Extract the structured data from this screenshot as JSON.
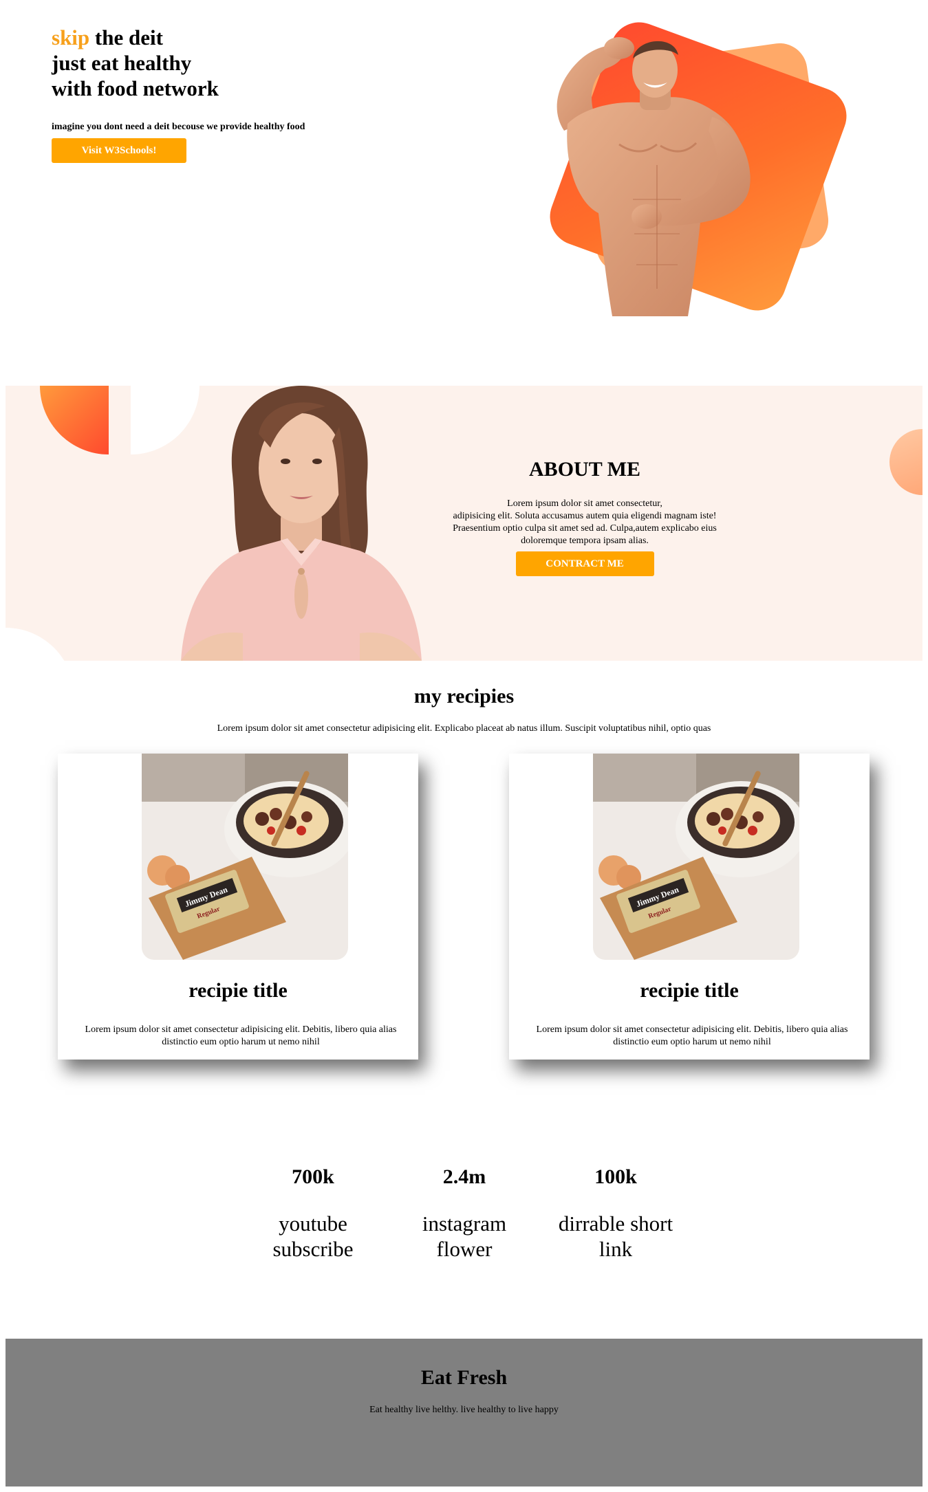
{
  "hero": {
    "title_accent": "skip",
    "title_line1_rest": " the deit",
    "title_line2": "just eat healthy",
    "title_line3": "with food network",
    "subtitle": "imagine you dont need a deit becouse we provide healthy food",
    "button_label": "Visit W3Schools!"
  },
  "about": {
    "title": "ABOUT ME",
    "text_line1": "Lorem ipsum dolor sit amet consectetur,",
    "text_line2": "adipisicing elit. Soluta accusamus autem quia eligendi magnam iste!",
    "text_line3": "Praesentium optio culpa sit amet sed ad. Culpa,autem explicabo eius",
    "text_line4": "doloremque tempora ipsam alias.",
    "button_label": "CONTRACT ME"
  },
  "recipes": {
    "title": "my recipies",
    "subtitle": "Lorem ipsum dolor sit amet consectetur adipisicing elit. Explicabo placeat ab natus illum. Suscipit voluptatibus nihil, optio quas",
    "cards": [
      {
        "title": "recipie title",
        "text": "Lorem ipsum dolor sit amet consectetur adipisicing elit. Debitis, libero quia alias distinctio eum optio harum ut nemo nihil",
        "package_brand": "Jimmy Dean",
        "package_label": "Regular"
      },
      {
        "title": "recipie title",
        "text": "Lorem ipsum dolor sit amet consectetur adipisicing elit. Debitis, libero quia alias distinctio eum optio harum ut nemo nihil",
        "package_brand": "Jimmy Dean",
        "package_label": "Regular"
      }
    ]
  },
  "stats": [
    {
      "value": "700k",
      "label_line1": "youtube",
      "label_line2": "subscribe"
    },
    {
      "value": "2.4m",
      "label_line1": "instagram",
      "label_line2": "flower"
    },
    {
      "value": "100k",
      "label_line1": "dirrable short",
      "label_line2": "link"
    }
  ],
  "footer": {
    "title": "Eat Fresh",
    "text": "Eat healthy live helthy. live healthy to live happy"
  },
  "colors": {
    "accent": "#ffa500",
    "accent_text": "#f7a01b",
    "about_bg": "#fdf2ec",
    "footer_bg": "#808080",
    "shape_orange": "#ff5a2e"
  }
}
